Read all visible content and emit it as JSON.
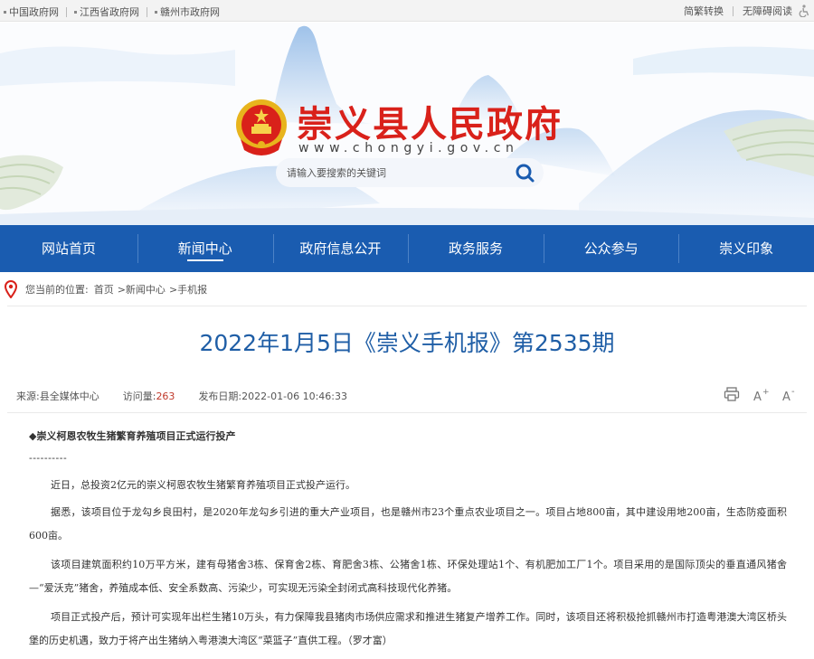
{
  "topbar": {
    "links": [
      "中国政府网",
      "江西省政府网",
      "赣州市政府网"
    ],
    "right_links": [
      "简繁转换",
      "无障碍阅读"
    ]
  },
  "header": {
    "title": "崇义县人民政府",
    "url": "www.chongyi.gov.cn",
    "search_placeholder": "请输入要搜索的关键词"
  },
  "nav": {
    "items": [
      "网站首页",
      "新闻中心",
      "政府信息公开",
      "政务服务",
      "公众参与",
      "崇义印象"
    ],
    "active": "新闻中心"
  },
  "breadcrumb": {
    "label": "您当前的位置:",
    "items": [
      "首页",
      ">新闻中心",
      ">手机报"
    ]
  },
  "article": {
    "title": "2022年1月5日《崇义手机报》第2535期",
    "meta": {
      "source_label": "来源:",
      "source": "县全媒体中心",
      "views_label": "访问量:",
      "views": "263",
      "date_label": "发布日期:",
      "date": "2022-01-06 10:46:33"
    },
    "tools": [
      "print-icon",
      "font-increase-icon",
      "font-decrease-icon"
    ],
    "headline": "◆崇义柯恩农牧生猪繁育养殖项目正式运行投产",
    "dashes": "----------",
    "paragraphs": [
      "近日，总投资2亿元的崇义柯恩农牧生猪繁育养殖项目正式投产运行。",
      "据悉，该项目位于龙勾乡良田村，是2020年龙勾乡引进的重大产业项目，也是赣州市23个重点农业项目之一。项目占地800亩，其中建设用地200亩，生态防疫面积600亩。",
      "该项目建筑面积约10万平方米，建有母猪舍3栋、保育舍2栋、育肥舍3栋、公猪舍1栋、环保处理站1个、有机肥加工厂1个。项目采用的是国际顶尖的垂直通风猪舍—“爱沃克”猪舍，养殖成本低、安全系数高、污染少，可实现无污染全封闭式高科技现代化养猪。",
      "项目正式投产后，预计可实现年出栏生猪10万头，有力保障我县猪肉市场供应需求和推进生猪复产增养工作。同时，该项目还将积极抢抓赣州市打造粤港澳大湾区桥头堡的历史机遇，致力于将产出生猪纳入粤港澳大湾区“菜篮子”直供工程。（罗才富）"
    ]
  },
  "colors": {
    "nav_bg": "#1a5cb0",
    "title_red": "#d9211a",
    "article_title": "#1f5ea6"
  }
}
